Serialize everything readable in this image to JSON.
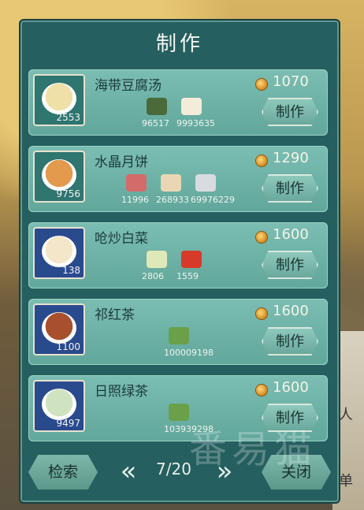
{
  "panel": {
    "title": "制作"
  },
  "recipes": [
    {
      "name": "海带豆腐汤",
      "price": "1070",
      "stock": "2553",
      "frame": "green",
      "dish_color": "#efe0a8",
      "ingredients": [
        {
          "icon": "seaweed-icon",
          "color": "#4a6a3a",
          "count": "96517"
        },
        {
          "icon": "tofu-icon",
          "color": "#f3ecd8",
          "count": "9993635"
        }
      ],
      "make_label": "制作"
    },
    {
      "name": "水晶月饼",
      "price": "1290",
      "stock": "9756",
      "frame": "green",
      "dish_color": "#e39a4c",
      "ingredients": [
        {
          "icon": "meat-icon",
          "color": "#d46b6b",
          "count": "11996"
        },
        {
          "icon": "flour-icon",
          "color": "#e9d7b3",
          "count": "268933"
        },
        {
          "icon": "sugar-bucket-icon",
          "color": "#d8dbe0",
          "count": "69976229"
        }
      ],
      "make_label": "制作"
    },
    {
      "name": "呛炒白菜",
      "price": "1600",
      "stock": "138",
      "frame": "blue",
      "dish_color": "#f3e6c9",
      "ingredients": [
        {
          "icon": "cabbage-icon",
          "color": "#dfe8b8",
          "count": "2806"
        },
        {
          "icon": "chili-icon",
          "color": "#d83a2a",
          "count": "1559"
        }
      ],
      "make_label": "制作"
    },
    {
      "name": "祁红茶",
      "price": "1600",
      "stock": "1100",
      "frame": "blue",
      "dish_color": "#a8502e",
      "ingredients": [
        {
          "icon": "tea-leaf-icon",
          "color": "#6aa04a",
          "count": "100009198"
        }
      ],
      "make_label": "制作"
    },
    {
      "name": "日照绿茶",
      "price": "1600",
      "stock": "9497",
      "frame": "blue",
      "dish_color": "#cfe3c0",
      "ingredients": [
        {
          "icon": "tea-leaf-icon",
          "color": "#6aa04a",
          "count": "103939298"
        }
      ],
      "make_label": "制作"
    }
  ],
  "footer": {
    "search_label": "检索",
    "page": "7/20",
    "close_label": "关闭",
    "prev_icon": "double-chevron-left-icon",
    "next_icon": "double-chevron-right-icon"
  },
  "side": {
    "char1": "人",
    "char2": "单"
  },
  "watermark": "番易猫"
}
